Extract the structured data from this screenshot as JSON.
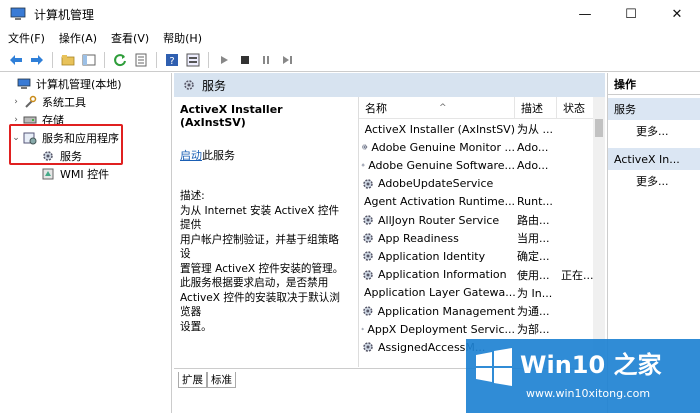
{
  "window": {
    "title": "计算机管理"
  },
  "window_controls": {
    "minimize": "—",
    "maximize": "☐",
    "close": "✕"
  },
  "menu": [
    "文件(F)",
    "操作(A)",
    "查看(V)",
    "帮助(H)"
  ],
  "tree": {
    "root": "计算机管理(本地)",
    "system_tools": "系统工具",
    "storage": "存储",
    "services_apps": "服务和应用程序",
    "services": "服务",
    "wmi": "WMI 控件"
  },
  "middle": {
    "header": "服务",
    "desc_title": "ActiveX Installer (AxInstSV)",
    "desc_link": "启动",
    "desc_link_suffix": "此服务",
    "desc_label": "描述:",
    "desc_lines": [
      "为从 Internet 安装 ActiveX 控件提供",
      "用户帐户控制验证，并基于组策略设",
      "置管理 ActiveX 控件安装的管理。",
      "此服务根据要求启动，是否禁用",
      "ActiveX 控件的安装取决于默认浏览器",
      "设置。"
    ],
    "columns": {
      "name": "名称",
      "desc": "描述",
      "status": "状态"
    },
    "services": [
      {
        "name": "ActiveX Installer (AxInstSV)",
        "desc": "为从 ...",
        "status": ""
      },
      {
        "name": "Adobe Genuine Monitor ...",
        "desc": "Ado...",
        "status": ""
      },
      {
        "name": "Adobe Genuine Software...",
        "desc": "Ado...",
        "status": ""
      },
      {
        "name": "AdobeUpdateService",
        "desc": "",
        "status": ""
      },
      {
        "name": "Agent Activation Runtime...",
        "desc": "Runt...",
        "status": ""
      },
      {
        "name": "AllJoyn Router Service",
        "desc": "路由...",
        "status": ""
      },
      {
        "name": "App Readiness",
        "desc": "当用...",
        "status": ""
      },
      {
        "name": "Application Identity",
        "desc": "确定...",
        "status": ""
      },
      {
        "name": "Application Information",
        "desc": "使用...",
        "status": "正在..."
      },
      {
        "name": "Application Layer Gatewa...",
        "desc": "为 In...",
        "status": ""
      },
      {
        "name": "Application Management",
        "desc": "为通...",
        "status": ""
      },
      {
        "name": "AppX Deployment Servic...",
        "desc": "为部...",
        "status": ""
      },
      {
        "name": "AssignedAccessM...",
        "desc": "",
        "status": ""
      }
    ],
    "tabs": [
      "扩展",
      "标准"
    ]
  },
  "actions": {
    "title": "操作",
    "section1": "服务",
    "more1": "更多...",
    "section2": "ActiveX In...",
    "more2": "更多..."
  },
  "watermark": {
    "brand": "Win10 之家",
    "url": "www.win10xitong.com"
  },
  "colors": {
    "header_bg": "#d7e3f0",
    "highlight_box": "#e02020",
    "watermark_bg": "#1e82d2"
  }
}
